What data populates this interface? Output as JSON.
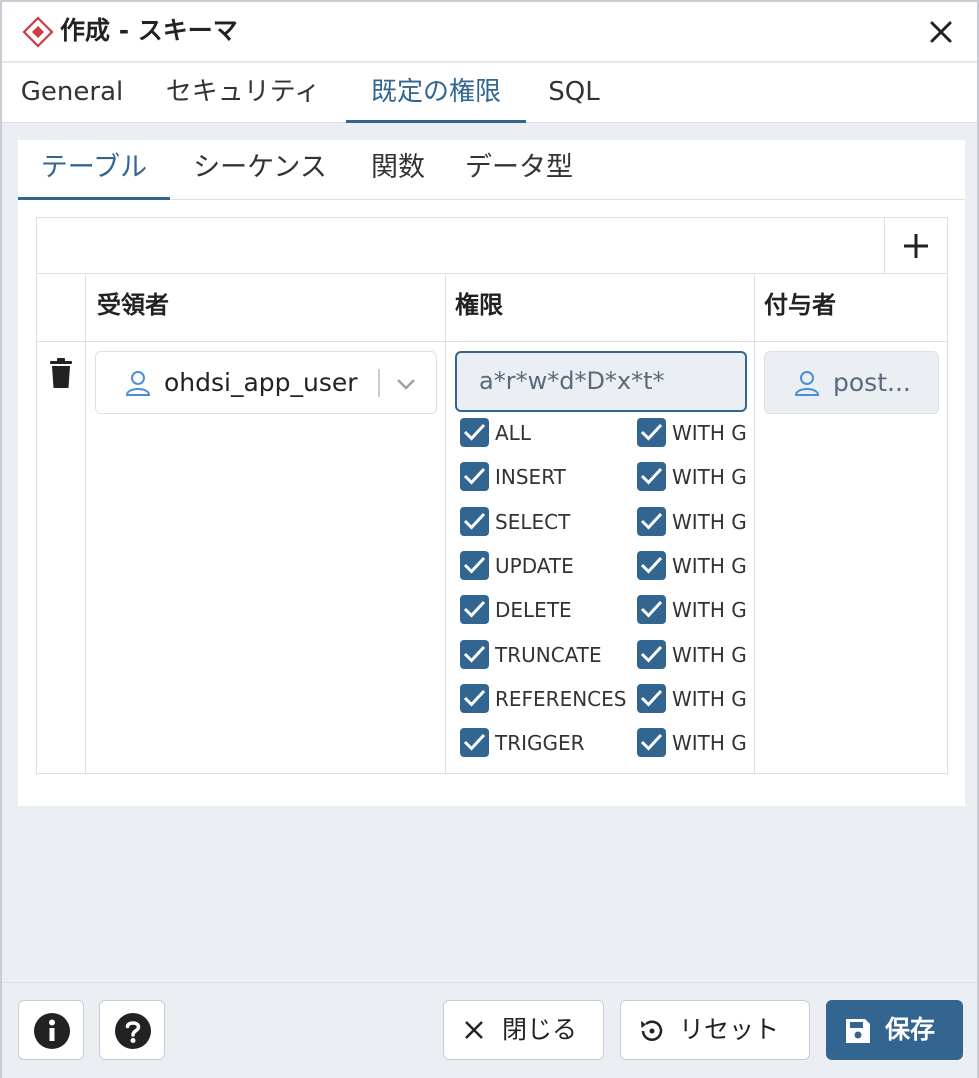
{
  "window": {
    "title": "作成 - スキーマ",
    "title_icon": "schema-diamond-icon",
    "close_icon": "close-icon"
  },
  "main_tabs": [
    {
      "label": "General",
      "active": false
    },
    {
      "label": "セキュリティ",
      "active": false
    },
    {
      "label": "既定の権限",
      "active": true
    },
    {
      "label": "SQL",
      "active": false
    }
  ],
  "sub_tabs": [
    {
      "label": "テーブル",
      "active": true
    },
    {
      "label": "シーケンス",
      "active": false
    },
    {
      "label": "関数",
      "active": false
    },
    {
      "label": "データ型",
      "active": false
    }
  ],
  "grid": {
    "add_icon": "plus-icon",
    "headers": {
      "grantee": "受領者",
      "privileges": "権限",
      "grantor": "付与者"
    },
    "row": {
      "delete_icon": "trash-icon",
      "grantee": "ohdsi_app_user",
      "privileges": "a*r*w*d*D*x*t*",
      "grantor": "post...",
      "privilege_list": [
        {
          "name": "ALL",
          "checked": true,
          "with_grant": "WITH G",
          "grant_checked": true
        },
        {
          "name": "INSERT",
          "checked": true,
          "with_grant": "WITH G",
          "grant_checked": true
        },
        {
          "name": "SELECT",
          "checked": true,
          "with_grant": "WITH G",
          "grant_checked": true
        },
        {
          "name": "UPDATE",
          "checked": true,
          "with_grant": "WITH G",
          "grant_checked": true
        },
        {
          "name": "DELETE",
          "checked": true,
          "with_grant": "WITH G",
          "grant_checked": true
        },
        {
          "name": "TRUNCATE",
          "checked": true,
          "with_grant": "WITH G",
          "grant_checked": true
        },
        {
          "name": "REFERENCES",
          "checked": true,
          "with_grant": "WITH G",
          "grant_checked": true
        },
        {
          "name": "TRIGGER",
          "checked": true,
          "with_grant": "WITH G",
          "grant_checked": true
        }
      ]
    }
  },
  "footer": {
    "info_icon": "info-icon",
    "help_icon": "help-icon",
    "close_label": "閉じる",
    "reset_label": "リセット",
    "save_label": "保存"
  },
  "colors": {
    "accent": "#326690",
    "brand_red": "#d0393e",
    "background": "#ebeef3",
    "border": "#dde0e5"
  }
}
